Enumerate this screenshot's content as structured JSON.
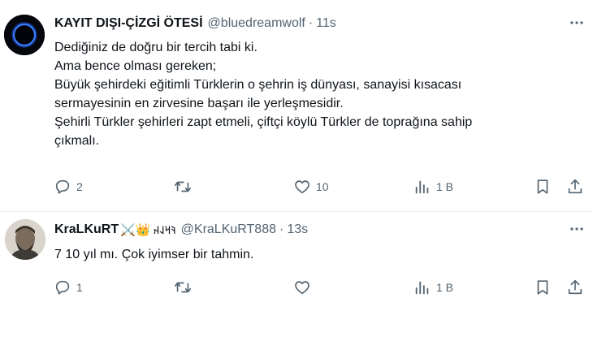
{
  "tweets": [
    {
      "author_name": "KAYIT DIŞI-ÇİZGİ ÖTESİ",
      "handle": "@bluedreamwolf",
      "separator": "·",
      "time": "11s",
      "more_icon": "more-horizontal-icon",
      "lines": [
        "Dediğiniz de doğru bir tercih tabi ki.",
        "Ama bence olması gereken;",
        "Büyük şehirdeki eğitimli Türklerin o şehrin iş dünyası, sanayisi  kısacası",
        "sermayesinin en zirvesine başarı ile yerleşmesidir.",
        "Şehirli Türkler şehirleri zapt etmeli, çiftçi köylü Türkler de toprağına sahip",
        "çıkmalı."
      ],
      "reply_count": "2",
      "retweet_count": "",
      "like_count": "10",
      "view_count": "1 B"
    },
    {
      "author_name": "KraLKuRT",
      "name_emojis": "⚔️👑",
      "name_script": "𐰚𐰺𐰞𐰴",
      "handle": "@KraLKuRT888",
      "separator": "·",
      "time": "13s",
      "more_icon": "more-horizontal-icon",
      "lines": [
        "7 10 yıl mı. Çok iyimser bir tahmin."
      ],
      "reply_count": "1",
      "retweet_count": "",
      "like_count": "",
      "view_count": "1 B"
    }
  ],
  "colors": {
    "text": "#0f1419",
    "secondary": "#536471",
    "divider": "#e6ecf0"
  },
  "icons": [
    "reply-icon",
    "retweet-icon",
    "like-icon",
    "views-icon",
    "bookmark-icon",
    "share-icon"
  ]
}
